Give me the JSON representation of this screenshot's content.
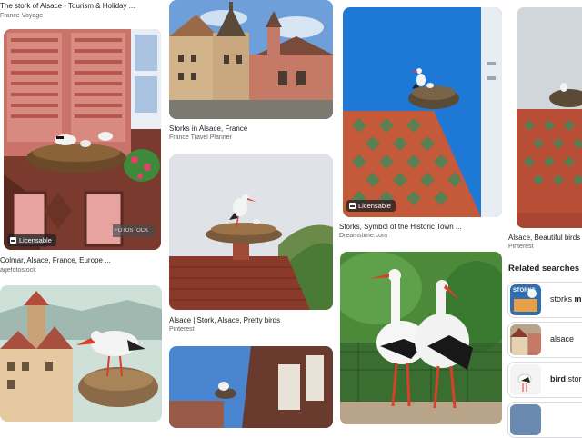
{
  "results": [
    {
      "title": "The stork of Alsace - Tourism & Holiday ...",
      "source": "France Voyage"
    },
    {
      "title": "Colmar, Alsace, France, Europe ...",
      "source": "agefotostock",
      "badge": "Licensable",
      "watermark": "FOTOSTOCK"
    },
    {
      "title": "Storks in Alsace, France",
      "source": "France Travel Planner"
    },
    {
      "title": "Alsace | Stork, Alsace, Pretty birds",
      "source": "Pinterest"
    },
    {
      "title": "Storks, Symbol of the Historic Town ...",
      "source": "Dreamstime.com",
      "badge": "Licensable"
    },
    {
      "title": "Alsace, Beautiful birds",
      "source": "Pinterest"
    }
  ],
  "related": {
    "title": "Related searches",
    "items": [
      {
        "prefix": "storks ",
        "bold": "m"
      },
      {
        "prefix": "alsace",
        "bold": ""
      },
      {
        "prefix": "",
        "bold": "bird",
        "suffix": " stor"
      }
    ],
    "thumb_text": "STORKS"
  },
  "colors": {
    "caption": "#202124",
    "source": "#5f6368",
    "badge_bg": "#202124",
    "sky": "#3d7fd1"
  }
}
